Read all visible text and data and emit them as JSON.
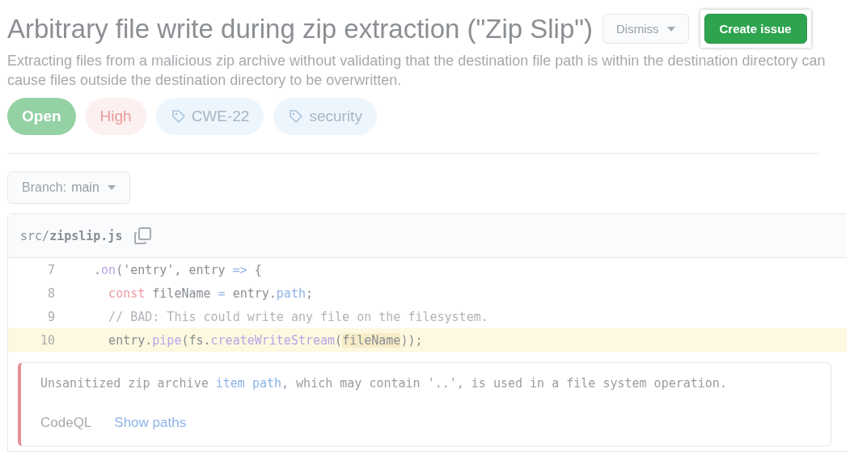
{
  "title": "Arbitrary file write during zip extraction (\"Zip Slip\")",
  "dismiss_button": {
    "label": "Dismiss"
  },
  "create_button": {
    "label": "Create issue"
  },
  "description": "Extracting files from a malicious zip archive without validating that the destination file path is within the destination directory can cause files outside the destination directory to be overwritten.",
  "labels": [
    {
      "kind": "status",
      "text": "Open"
    },
    {
      "kind": "severity",
      "text": "High"
    },
    {
      "kind": "tag",
      "text": "CWE-22"
    },
    {
      "kind": "tag",
      "text": "security"
    }
  ],
  "branch": {
    "prefix": "Branch:",
    "value": "main"
  },
  "file": {
    "dir": "src/",
    "name": "zipslip.js"
  },
  "code_lines": [
    {
      "number": "7",
      "highlighted": false,
      "tokens": [
        {
          "kind": "plain",
          "text": "  ."
        },
        {
          "kind": "method",
          "text": "on"
        },
        {
          "kind": "plain",
          "text": "('entry', entry "
        },
        {
          "kind": "operator",
          "text": "=>"
        },
        {
          "kind": "plain",
          "text": " {"
        }
      ]
    },
    {
      "number": "8",
      "highlighted": false,
      "tokens": [
        {
          "kind": "keyword",
          "text": "    const"
        },
        {
          "kind": "plain",
          "text": " fileName "
        },
        {
          "kind": "operator",
          "text": "="
        },
        {
          "kind": "plain",
          "text": " entry."
        },
        {
          "kind": "operator",
          "text": "path"
        },
        {
          "kind": "plain",
          "text": ";"
        }
      ]
    },
    {
      "number": "9",
      "highlighted": false,
      "tokens": [
        {
          "kind": "comment",
          "text": "    // BAD: This could write any file on the filesystem."
        }
      ]
    },
    {
      "number": "10",
      "highlighted": true,
      "tokens": [
        {
          "kind": "plain",
          "text": "    entry."
        },
        {
          "kind": "method",
          "text": "pipe"
        },
        {
          "kind": "plain",
          "text": "(fs."
        },
        {
          "kind": "method",
          "text": "createWriteStream"
        },
        {
          "kind": "plain",
          "text": "("
        },
        {
          "kind": "match",
          "text": "fileName"
        },
        {
          "kind": "plain",
          "text": "));"
        }
      ]
    }
  ],
  "alert": {
    "message": [
      {
        "kind": "plain",
        "text": "Unsanitized zip archive "
      },
      {
        "kind": "link",
        "text": "item path"
      },
      {
        "kind": "plain",
        "text": ", which may contain '..', is used in a file system operation."
      }
    ],
    "tool": "CodeQL",
    "show_paths": "Show paths"
  }
}
